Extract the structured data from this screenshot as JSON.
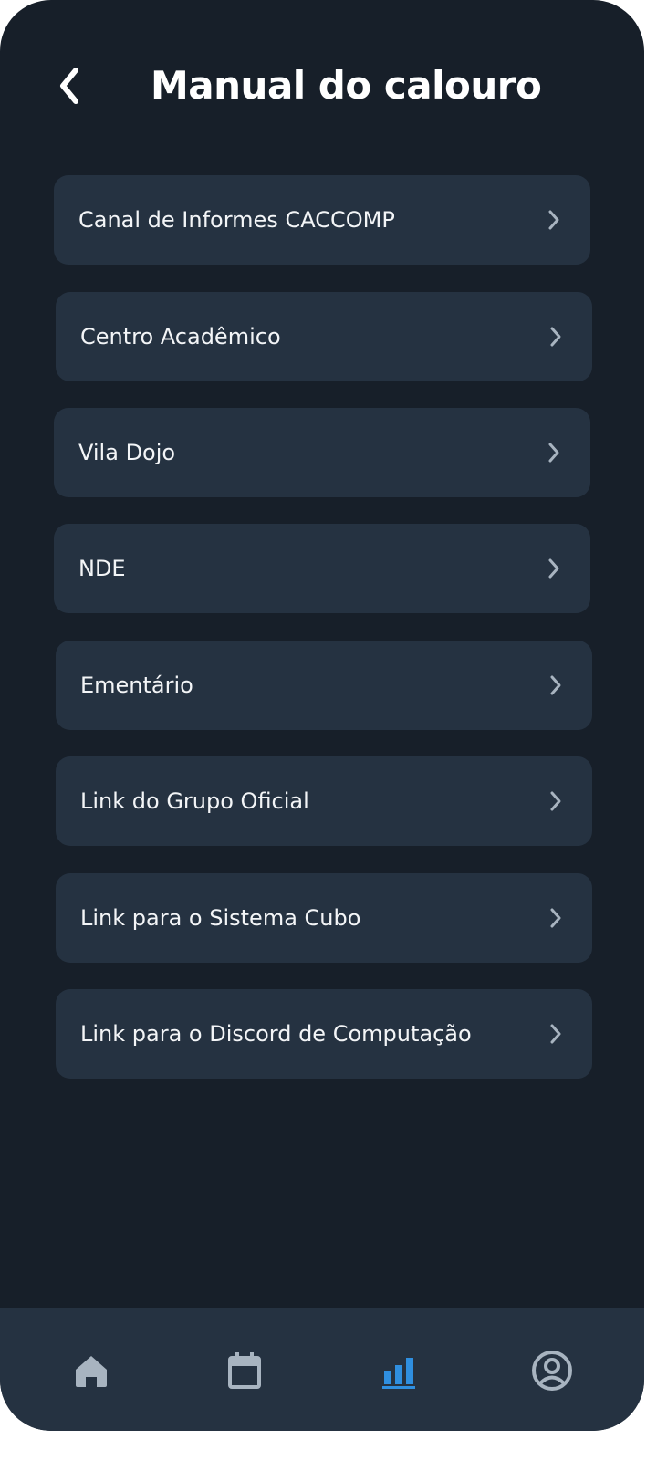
{
  "header": {
    "title": "Manual do calouro",
    "back_icon": "chevron-left-icon"
  },
  "menu": {
    "items": [
      {
        "label": "Canal de Informes CACCOMP",
        "icon": "chevron-right-icon"
      },
      {
        "label": "Centro Acadêmico",
        "icon": "chevron-right-icon"
      },
      {
        "label": "Vila Dojo",
        "icon": "chevron-right-icon"
      },
      {
        "label": "NDE",
        "icon": "chevron-right-icon"
      },
      {
        "label": "Ementário",
        "icon": "chevron-right-icon"
      },
      {
        "label": "Link do Grupo Oficial",
        "icon": "chevron-right-icon"
      },
      {
        "label": "Link para o Sistema Cubo",
        "icon": "chevron-right-icon"
      },
      {
        "label": "Link para o Discord de Computação",
        "icon": "chevron-right-icon"
      }
    ]
  },
  "bottom_nav": {
    "items": [
      {
        "icon": "home-icon",
        "active": false
      },
      {
        "icon": "calendar-icon",
        "active": false
      },
      {
        "icon": "bar-chart-icon",
        "active": true
      },
      {
        "icon": "user-profile-icon",
        "active": false
      }
    ]
  },
  "colors": {
    "background": "#171f29",
    "card": "#253241",
    "text": "#ffffff",
    "icon_muted": "#a8b4c0",
    "accent": "#2f8fe0"
  }
}
